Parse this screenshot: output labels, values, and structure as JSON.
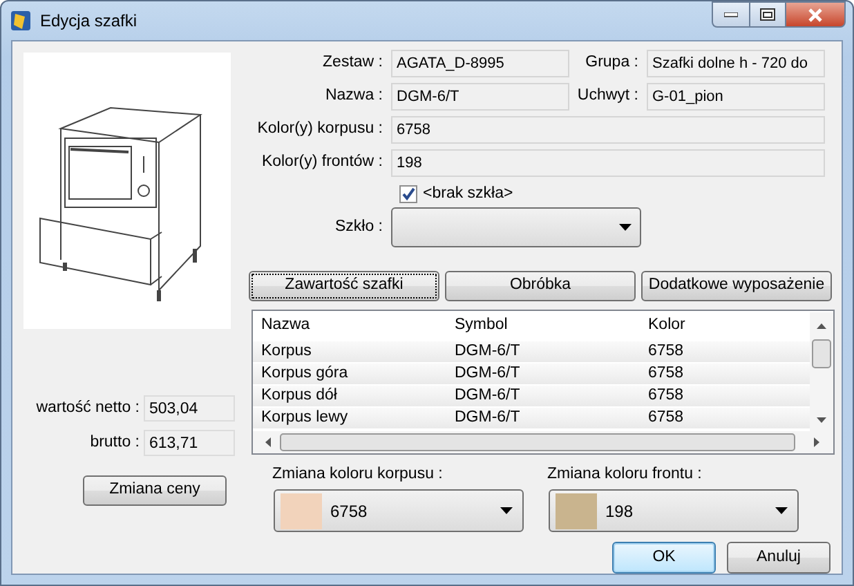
{
  "window": {
    "title": "Edycja szafki"
  },
  "fields": [
    {
      "label": "Zestaw :",
      "value": "AGATA_D-8995"
    },
    {
      "label": "Grupa :",
      "value": "Szafki dolne h - 720 do"
    },
    {
      "label": "Nazwa :",
      "value": "DGM-6/T"
    },
    {
      "label": "Uchwyt :",
      "value": "G-01_pion"
    },
    {
      "label": "Kolor(y) korpusu :",
      "value": "6758"
    },
    {
      "label": "Kolor(y) frontów :",
      "value": "198"
    }
  ],
  "glass": {
    "checkbox": {
      "label": "<brak szkła>",
      "checked": true
    },
    "combo": {
      "label": "Szkło :"
    }
  },
  "tabs": [
    {
      "label": "Zawartość szafki",
      "selected": true
    },
    {
      "label": "Obróbka",
      "selected": false
    },
    {
      "label": "Dodatkowe wyposażenie",
      "selected": false
    }
  ],
  "table": {
    "columns": [
      "Nazwa",
      "Symbol",
      "Kolor"
    ],
    "rows": [
      [
        "Korpus",
        "DGM-6/T",
        "6758"
      ],
      [
        "Korpus góra",
        "DGM-6/T",
        "6758"
      ],
      [
        "Korpus dół",
        "DGM-6/T",
        "6758"
      ],
      [
        "Korpus lewy",
        "DGM-6/T",
        "6758"
      ]
    ]
  },
  "price": {
    "net": {
      "label": "wartość netto :",
      "value": "503,04"
    },
    "gross": {
      "label": "brutto :",
      "value": "613,71"
    },
    "button": "Zmiana ceny"
  },
  "color_changes": [
    {
      "label": "Zmiana koloru korpusu :",
      "value": "6758",
      "color": "#f2d3bb"
    },
    {
      "label": "Zmiana koloru frontu :",
      "value": "198",
      "color": "#c9b48e"
    }
  ],
  "buttons": [
    {
      "label": "OK",
      "default": true
    },
    {
      "label": "Anuluj",
      "default": false
    }
  ]
}
